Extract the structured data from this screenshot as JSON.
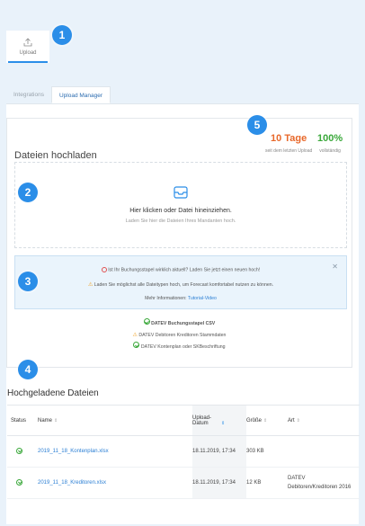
{
  "badges": [
    "1",
    "2",
    "3",
    "4",
    "5"
  ],
  "upload": {
    "label": "Upload"
  },
  "tabs": [
    {
      "label": "Integrations"
    },
    {
      "label": "Upload Manager"
    }
  ],
  "card": {
    "title": "Dateien hochladen",
    "stat_days": {
      "value": "10 Tage",
      "caption": "seit dem letzten Upload",
      "color": "#e8682a"
    },
    "stat_pct": {
      "value": "100%",
      "caption": "vollständig",
      "color": "#3aa83a"
    },
    "drop": {
      "title": "Hier klicken oder Datei hineinziehen.",
      "subtitle": "Laden Sie hier die Dateien Ihres Mandanten hoch."
    },
    "info": {
      "line1": "Ist Ihr Buchungsstapel wirklich aktuell? Laden Sie jetzt einen neuen hoch!",
      "line2": "Laden Sie möglichst alle Dateitypen hoch, um Forecast komfortabel nutzen zu können.",
      "line3_prefix": "Mehr Informationen:",
      "line3_link": "Tutorial-Video"
    },
    "checklist": [
      {
        "label": "DATEV Buchungsstapel CSV",
        "status": "ok"
      },
      {
        "label": "DATEV Debitoren Kreditoren Stammdaten",
        "status": "warn"
      },
      {
        "label": "DATEV Kontenplan oder SKBeschriftung",
        "status": "ok"
      }
    ]
  },
  "files": {
    "title": "Hochgeladene Dateien",
    "columns": {
      "status": "Status",
      "name": "Name",
      "date": "Upload-Datum",
      "size": "Größe",
      "type": "Art"
    },
    "rows": [
      {
        "name": "2019_11_18_Kontenplan.xlsx",
        "date": "18.11.2019, 17:34",
        "size": "303 KB",
        "type": ""
      },
      {
        "name": "2019_11_18_Kreditoren.xlsx",
        "date": "18.11.2019, 17:34",
        "size": "12 KB",
        "type": "DATEV Debitoren/Kreditoren 2016"
      }
    ]
  }
}
